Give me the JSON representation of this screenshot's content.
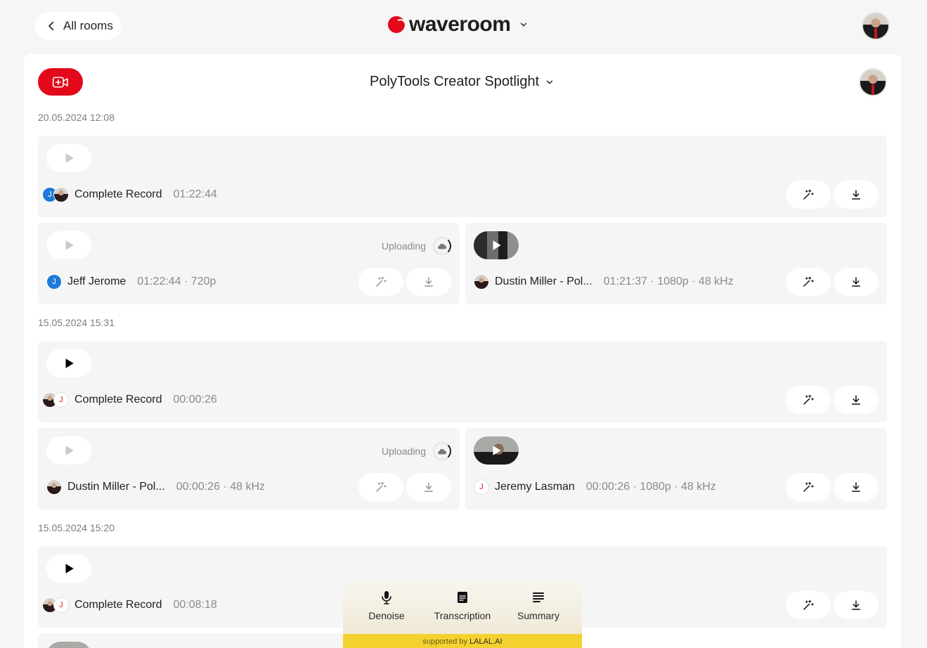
{
  "nav": {
    "back_label": "All rooms",
    "logo_text": "waveroom"
  },
  "room": {
    "title": "PolyTools Creator Spotlight"
  },
  "sessions": [
    {
      "date": "20.05.2024 12:08",
      "complete": {
        "label": "Complete Record",
        "duration": "01:22:44"
      },
      "tracks": [
        {
          "name": "Jeff Jerome",
          "info": "01:22:44 · 720p",
          "status": "Uploading"
        },
        {
          "name": "Dustin Miller - Pol...",
          "info": "01:21:37 · 1080p · 48 kHz"
        }
      ]
    },
    {
      "date": "15.05.2024 15:31",
      "complete": {
        "label": "Complete Record",
        "duration": "00:00:26"
      },
      "tracks": [
        {
          "name": "Dustin Miller - Pol...",
          "info": "00:00:26 · 48 kHz",
          "status": "Uploading"
        },
        {
          "name": "Jeremy Lasman",
          "info": "00:00:26 · 1080p · 48 kHz"
        }
      ]
    },
    {
      "date": "15.05.2024 15:20",
      "complete": {
        "label": "Complete Record",
        "duration": "00:08:18"
      }
    }
  ],
  "avatar_initials": {
    "jeff": "J",
    "jeremy": "J"
  },
  "tools": {
    "denoise": "Denoise",
    "transcription": "Transcription",
    "summary": "Summary"
  },
  "support": {
    "prefix": "supported by",
    "brand": "LALAL.AI"
  },
  "colors": {
    "brand_red": "#e4081b",
    "jeff_blue": "#1f7ad8",
    "support_yellow": "#f3d230"
  },
  "icons": [
    "chevron-left-icon",
    "chevron-down-icon",
    "video-plus-icon",
    "play-icon",
    "magic-wand-icon",
    "download-icon",
    "cloud-upload-icon",
    "microphone-icon",
    "transcription-icon",
    "summary-icon"
  ]
}
